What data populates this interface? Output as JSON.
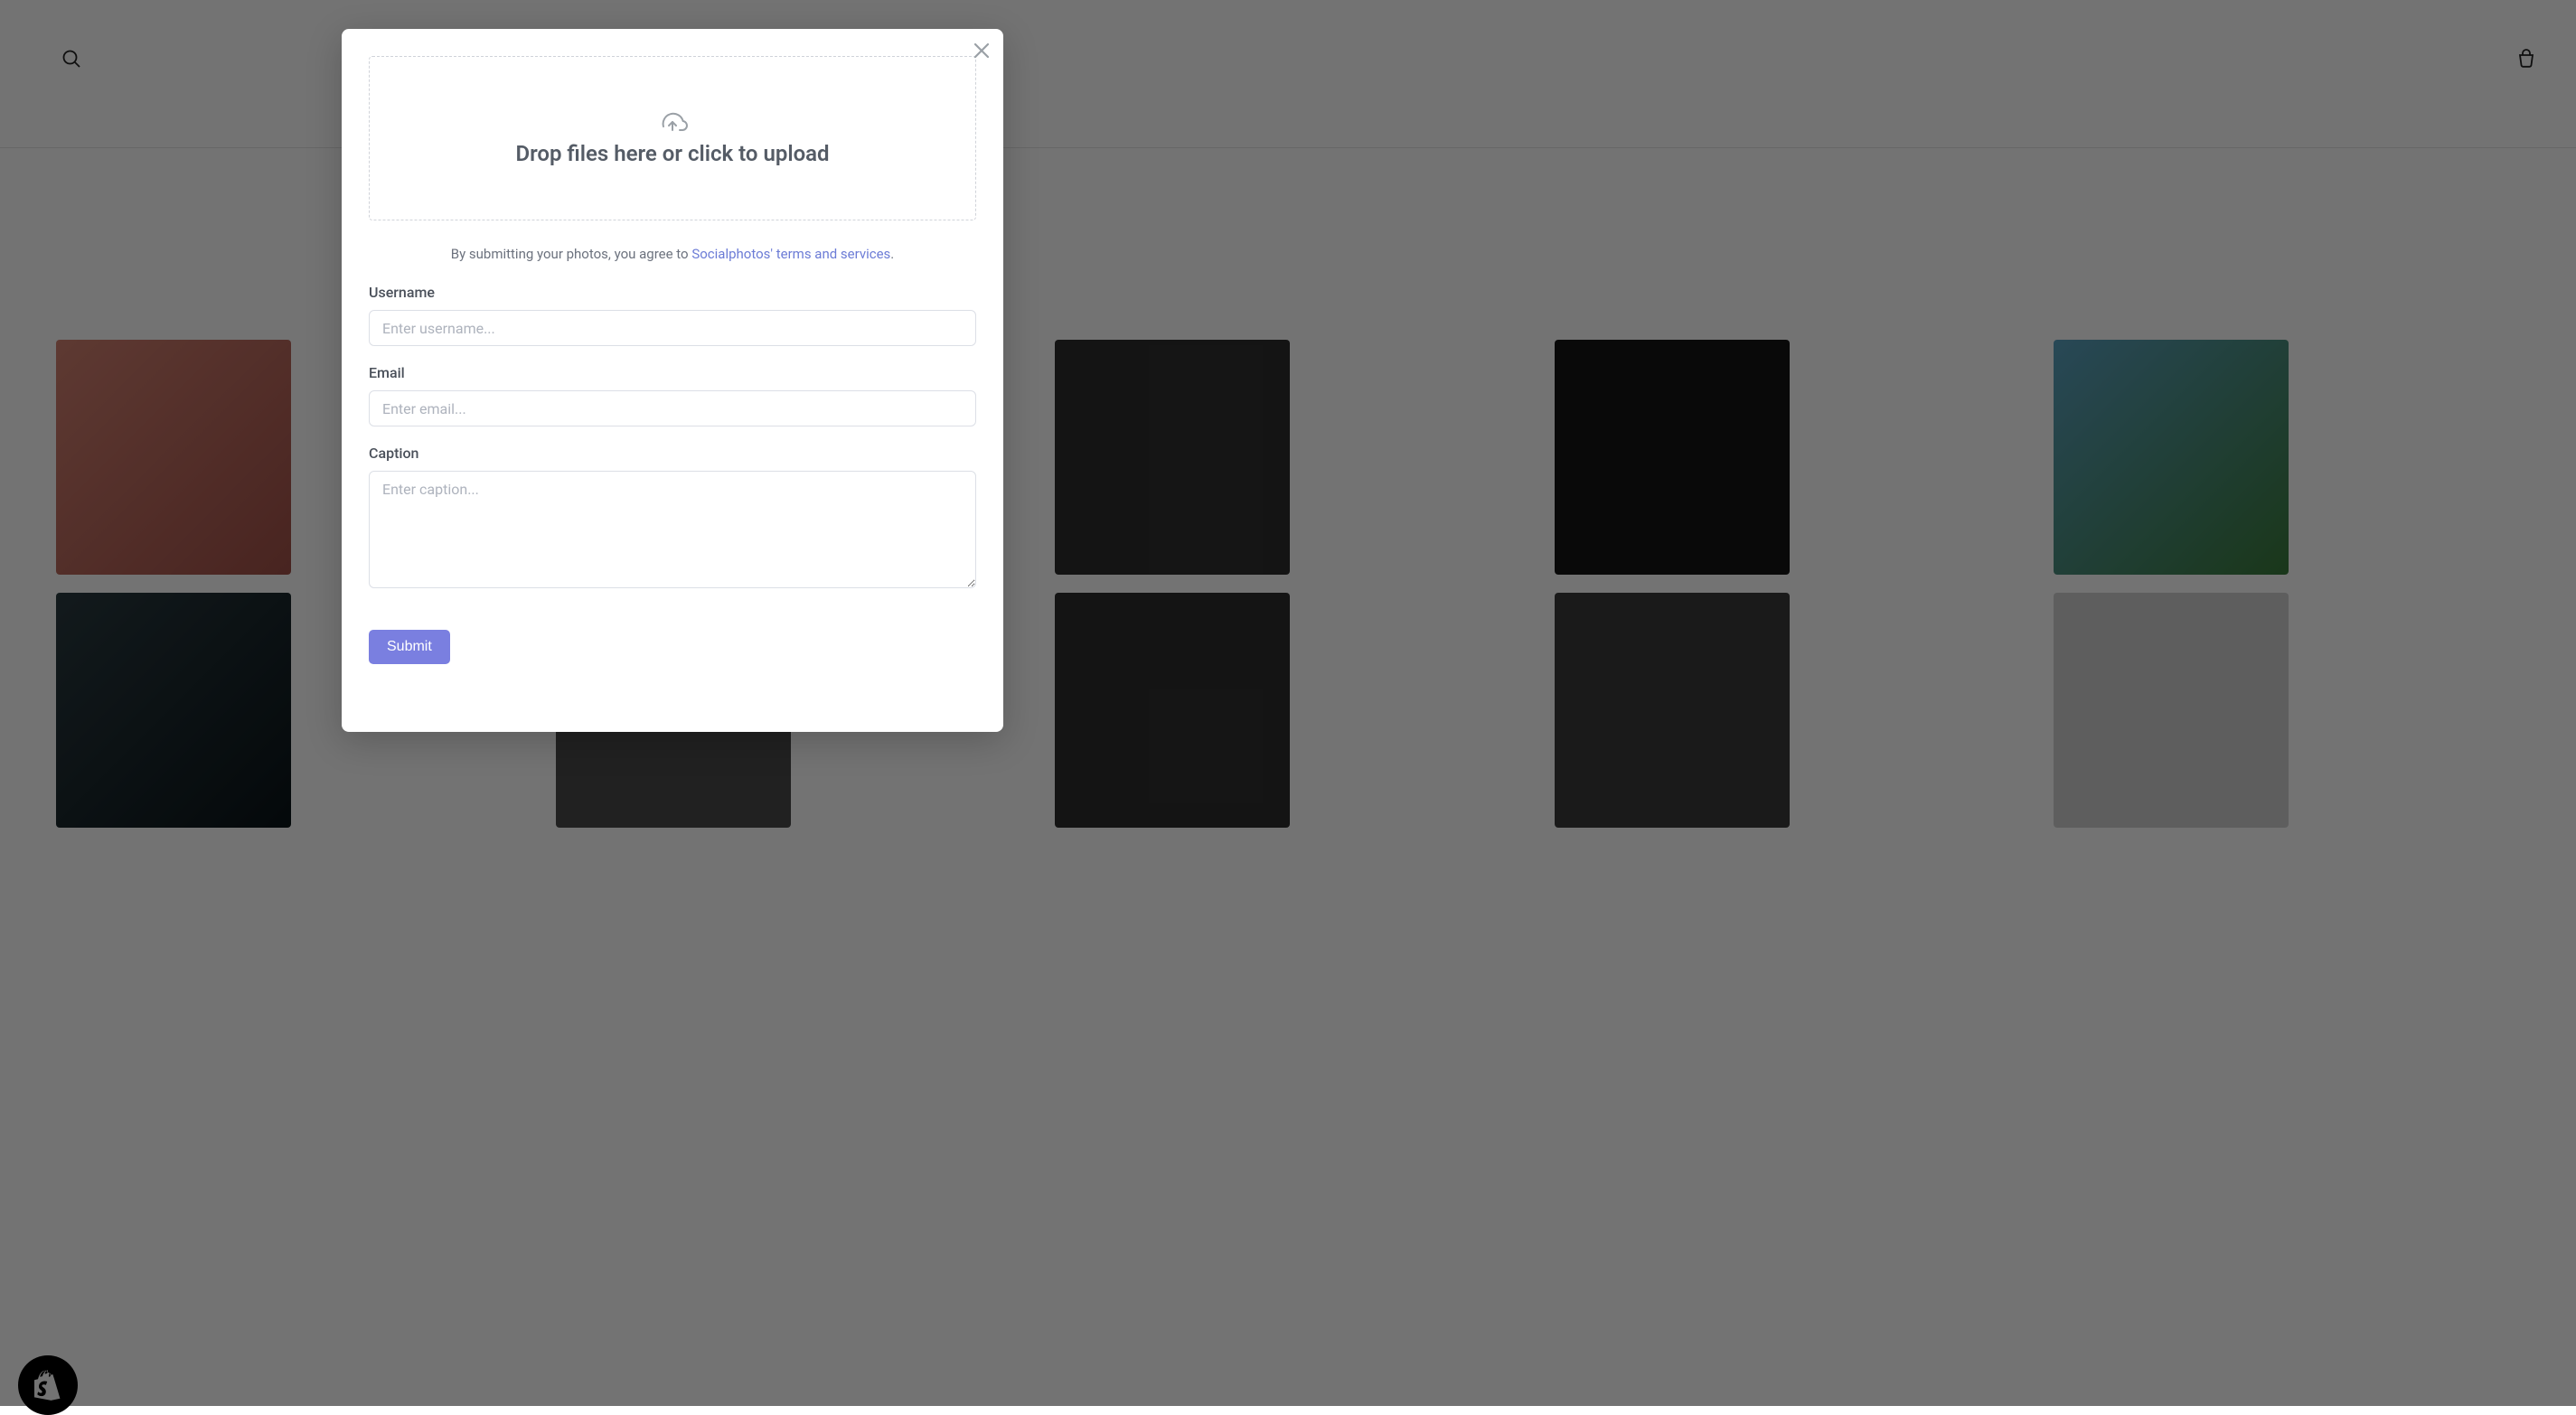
{
  "header": {
    "search_icon": "search-icon",
    "cart_icon": "cart-icon"
  },
  "gallery": {
    "row1_colors": [
      "#c9776f",
      "#2a1e1c",
      "#2e2e2e",
      "#1a1a1a",
      "#7a8fa0"
    ],
    "row2_colors": [
      "#2a3338",
      "#4a4a4a",
      "#2e2e2e",
      "#3a3a3a",
      "#c8c8c8"
    ]
  },
  "modal": {
    "dropzone_text": "Drop files here or click to upload",
    "disclaimer_prefix": "By submitting your photos, you agree to ",
    "disclaimer_link": "Socialphotos' terms and services",
    "disclaimer_suffix": ".",
    "fields": {
      "username": {
        "label": "Username",
        "placeholder": "Enter username..."
      },
      "email": {
        "label": "Email",
        "placeholder": "Enter email..."
      },
      "caption": {
        "label": "Caption",
        "placeholder": "Enter caption..."
      }
    },
    "submit_label": "Submit"
  }
}
